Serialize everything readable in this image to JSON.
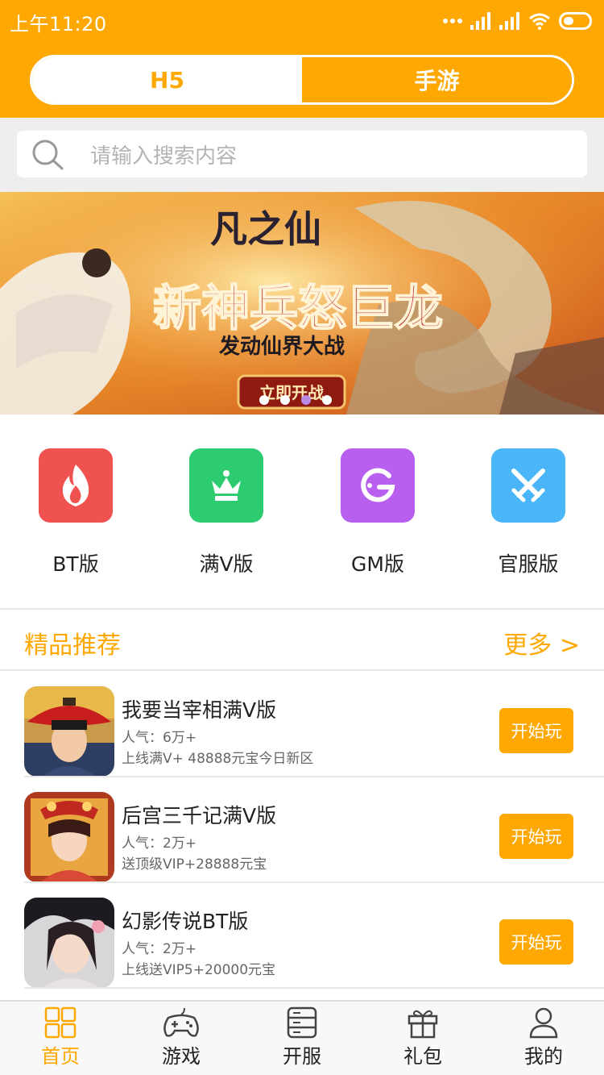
{
  "status": {
    "time": "上午11:20"
  },
  "segment": {
    "left": "H5",
    "right": "手游"
  },
  "search": {
    "placeholder": "请输入搜索内容"
  },
  "banner": {
    "game_logo": "凡之仙",
    "headline": "新神兵怒巨龙",
    "subline": "发动仙界大战",
    "cta": "立即开战"
  },
  "categories": [
    {
      "label": "BT版",
      "icon": "flame-icon",
      "color": "#f0524f"
    },
    {
      "label": "满V版",
      "icon": "crown-icon",
      "color": "#2ecc71"
    },
    {
      "label": "GM版",
      "icon": "gm-icon",
      "color": "#b85ff0"
    },
    {
      "label": "官服版",
      "icon": "crossed-swords-icon",
      "color": "#4ab6f7"
    }
  ],
  "section": {
    "title": "精品推荐",
    "more": "更多 >"
  },
  "games": [
    {
      "name": "我要当宰相满V版",
      "popularity": "人气：6万+",
      "desc": "上线满V+ 48888元宝今日新区",
      "button": "开始玩"
    },
    {
      "name": "后宫三千记满V版",
      "popularity": "人气：2万+",
      "desc": "送顶级VIP+28888元宝",
      "button": "开始玩"
    },
    {
      "name": "幻影传说BT版",
      "popularity": "人气：2万+",
      "desc": "上线送VIP5+20000元宝",
      "button": "开始玩"
    }
  ],
  "tabs": [
    {
      "label": "首页",
      "icon": "home-grid-icon"
    },
    {
      "label": "游戏",
      "icon": "gamepad-icon"
    },
    {
      "label": "开服",
      "icon": "server-icon"
    },
    {
      "label": "礼包",
      "icon": "gift-icon"
    },
    {
      "label": "我的",
      "icon": "user-icon"
    }
  ],
  "colors": {
    "accent": "#fea801",
    "text": "#222222",
    "muted": "#666666"
  }
}
